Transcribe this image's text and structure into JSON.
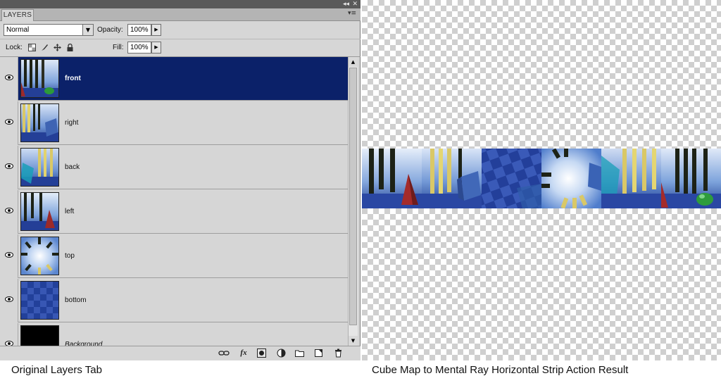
{
  "panel": {
    "tab_label": "LAYERS",
    "collapse_glyph": "◂◂",
    "close_glyph": "✕",
    "menu_glyph": "▾≡",
    "blend_mode": "Normal",
    "opacity_label": "Opacity:",
    "opacity_value": "100%",
    "lock_label": "Lock:",
    "fill_label": "Fill:",
    "fill_value": "100%",
    "layers": [
      {
        "name": "front",
        "selected": true
      },
      {
        "name": "right",
        "selected": false
      },
      {
        "name": "back",
        "selected": false
      },
      {
        "name": "left",
        "selected": false
      },
      {
        "name": "top",
        "selected": false
      },
      {
        "name": "bottom",
        "selected": false
      },
      {
        "name": "Background",
        "selected": false
      }
    ],
    "footer_icons": [
      "link-icon",
      "fx-icon",
      "mask-icon",
      "adjustment-icon",
      "folder-icon",
      "new-layer-icon",
      "trash-icon"
    ]
  },
  "captions": {
    "left": "Original Layers Tab",
    "right": "Cube Map to Mental Ray Horizontal Strip Action Result"
  },
  "colors": {
    "selected_row": "#0b2169",
    "panel_bg": "#d6d6d6"
  }
}
